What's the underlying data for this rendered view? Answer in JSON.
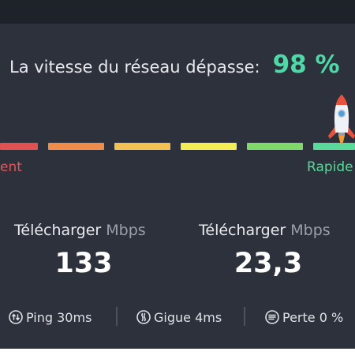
{
  "headline": {
    "text": "La vitesse du réseau dépasse:",
    "percent": "98 %"
  },
  "speed_bar": {
    "segments": [
      {
        "color": "#e05152"
      },
      {
        "color": "#ef8c4c"
      },
      {
        "color": "#f3c151"
      },
      {
        "color": "#f4ee55"
      },
      {
        "color": "#7fd86a"
      },
      {
        "color": "#59d99a"
      }
    ],
    "left_label": "ent",
    "right_label": "Rapide",
    "rocket_icon": "rocket-icon"
  },
  "stats": [
    {
      "label": "Télécharger",
      "unit": "Mbps",
      "value": "133"
    },
    {
      "label": "Télécharger",
      "unit": "Mbps",
      "value": "23,3"
    }
  ],
  "metrics": {
    "ping": {
      "icon": "ping-icon",
      "label": "Ping 30ms"
    },
    "jitter": {
      "icon": "jitter-icon",
      "label": "Gigue 4ms"
    },
    "loss": {
      "icon": "loss-icon",
      "label": "Perte 0 %"
    }
  },
  "colors": {
    "background": "#2c313b",
    "accent": "#4fd8a8"
  }
}
